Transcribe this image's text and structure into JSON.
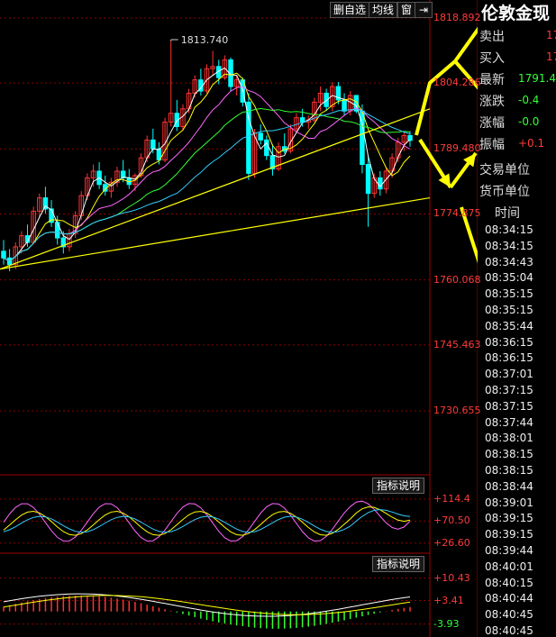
{
  "toolbar": {
    "delete_label": "删自选",
    "ma_label": "均线",
    "window_label": "窗"
  },
  "quote_panel": {
    "title": "伦敦金现",
    "rows": [
      {
        "label": "卖出",
        "value": "17",
        "color": "#ff3b3b"
      },
      {
        "label": "买入",
        "value": "17",
        "color": "#ff3b3b"
      },
      {
        "label": "最新",
        "value": "1791.4",
        "color": "#33ff33"
      },
      {
        "label": "涨跌",
        "value": "-0.4",
        "color": "#33ff33"
      },
      {
        "label": "涨幅",
        "value": "-0.0",
        "color": "#33ff33"
      },
      {
        "label": "振幅",
        "value": "+0.1",
        "color": "#ff3b3b"
      }
    ],
    "trade_unit_label": "交易单位",
    "currency_unit_label": "货币单位",
    "time_header": "时间",
    "times": [
      "08:34:15",
      "08:34:15",
      "08:34:43",
      "08:35:04",
      "08:35:15",
      "08:35:15",
      "08:35:44",
      "08:36:15",
      "08:36:15",
      "08:37:01",
      "08:37:15",
      "08:37:15",
      "08:37:44",
      "08:38:01",
      "08:38:15",
      "08:38:15",
      "08:38:44",
      "08:39:01",
      "08:39:15",
      "08:39:15",
      "08:39:44",
      "08:40:01",
      "08:40:15",
      "08:40:44",
      "08:40:45",
      "08:40:45"
    ]
  },
  "indicator_button_label": "指标说明",
  "colors": {
    "up": "#ff3333",
    "down": "#00ffff",
    "ma_white": "#ffffff",
    "ma_yellow": "#ffff00",
    "ma_magenta": "#ff66ff",
    "ma_green": "#33ff33",
    "ma_blue": "#33ccff",
    "grid": "#8b0000",
    "arrow": "#ffff00"
  },
  "chart_data": [
    {
      "type": "candlestick",
      "price_axis_labels": [
        "1818.892",
        "1804.286",
        "1789.480",
        "1774.875",
        "1760.068",
        "1745.463",
        "1730.655"
      ],
      "ylim": [
        1730.655,
        1818.892
      ],
      "high_annotation": "1813.740",
      "ohlc": [
        [
          1766.5,
          1769.0,
          1763.5,
          1765.0
        ],
        [
          1765.0,
          1767.0,
          1762.0,
          1763.5
        ],
        [
          1763.5,
          1768.5,
          1762.5,
          1767.5
        ],
        [
          1767.5,
          1771.0,
          1766.0,
          1770.0
        ],
        [
          1770.0,
          1772.5,
          1767.5,
          1768.5
        ],
        [
          1768.5,
          1776.5,
          1768.0,
          1775.5
        ],
        [
          1775.5,
          1779.5,
          1774.0,
          1778.5
        ],
        [
          1778.5,
          1781.0,
          1775.0,
          1776.0
        ],
        [
          1776.0,
          1778.0,
          1772.0,
          1773.0
        ],
        [
          1773.0,
          1774.5,
          1768.0,
          1769.5
        ],
        [
          1769.5,
          1771.0,
          1766.0,
          1767.5
        ],
        [
          1767.5,
          1771.5,
          1766.5,
          1770.5
        ],
        [
          1770.5,
          1775.5,
          1769.5,
          1774.5
        ],
        [
          1774.5,
          1780.0,
          1773.5,
          1779.0
        ],
        [
          1779.0,
          1784.0,
          1778.0,
          1783.0
        ],
        [
          1783.0,
          1786.0,
          1781.0,
          1784.5
        ],
        [
          1784.5,
          1786.5,
          1780.5,
          1781.5
        ],
        [
          1781.5,
          1783.5,
          1779.0,
          1780.0
        ],
        [
          1780.0,
          1783.0,
          1778.5,
          1782.0
        ],
        [
          1782.0,
          1785.5,
          1781.0,
          1784.5
        ],
        [
          1784.5,
          1787.0,
          1782.0,
          1783.0
        ],
        [
          1783.0,
          1785.0,
          1780.5,
          1781.5
        ],
        [
          1781.5,
          1784.0,
          1780.0,
          1783.5
        ],
        [
          1783.5,
          1788.5,
          1783.0,
          1787.5
        ],
        [
          1787.5,
          1792.5,
          1786.5,
          1791.5
        ],
        [
          1791.5,
          1794.0,
          1788.5,
          1789.5
        ],
        [
          1789.5,
          1791.0,
          1786.0,
          1787.0
        ],
        [
          1787.0,
          1796.5,
          1786.5,
          1795.5
        ],
        [
          1795.5,
          1813.7,
          1794.5,
          1797.5
        ],
        [
          1797.5,
          1800.5,
          1793.5,
          1794.5
        ],
        [
          1794.5,
          1799.5,
          1793.5,
          1798.5
        ],
        [
          1798.5,
          1803.0,
          1797.5,
          1802.0
        ],
        [
          1802.0,
          1806.0,
          1801.0,
          1805.0
        ],
        [
          1805.0,
          1807.5,
          1801.5,
          1802.5
        ],
        [
          1802.5,
          1808.5,
          1802.0,
          1807.5
        ],
        [
          1807.5,
          1811.5,
          1806.0,
          1808.0
        ],
        [
          1808.0,
          1809.5,
          1804.0,
          1805.5
        ],
        [
          1805.5,
          1810.5,
          1805.0,
          1809.5
        ],
        [
          1809.5,
          1810.0,
          1802.5,
          1803.5
        ],
        [
          1803.5,
          1806.0,
          1801.5,
          1805.0
        ],
        [
          1805.0,
          1805.5,
          1799.0,
          1800.0
        ],
        [
          1800.0,
          1802.0,
          1782.5,
          1784.0
        ],
        [
          1784.0,
          1794.0,
          1783.0,
          1793.0
        ],
        [
          1793.0,
          1795.0,
          1790.5,
          1791.5
        ],
        [
          1791.5,
          1792.5,
          1787.0,
          1788.0
        ],
        [
          1788.0,
          1790.5,
          1783.5,
          1785.0
        ],
        [
          1785.0,
          1791.0,
          1784.5,
          1790.0
        ],
        [
          1790.0,
          1793.0,
          1788.5,
          1789.0
        ],
        [
          1789.0,
          1795.0,
          1788.5,
          1794.0
        ],
        [
          1794.0,
          1797.5,
          1793.0,
          1796.5
        ],
        [
          1796.5,
          1798.5,
          1794.5,
          1795.5
        ],
        [
          1795.5,
          1797.0,
          1794.0,
          1796.0
        ],
        [
          1796.0,
          1801.0,
          1795.5,
          1800.0
        ],
        [
          1800.0,
          1803.5,
          1798.0,
          1802.0
        ],
        [
          1802.0,
          1803.0,
          1798.0,
          1799.0
        ],
        [
          1799.0,
          1804.5,
          1798.0,
          1803.5
        ],
        [
          1803.5,
          1804.5,
          1799.5,
          1800.5
        ],
        [
          1800.5,
          1802.0,
          1797.0,
          1798.0
        ],
        [
          1798.0,
          1802.5,
          1797.0,
          1801.5
        ],
        [
          1801.5,
          1801.5,
          1797.5,
          1798.0
        ],
        [
          1798.0,
          1799.5,
          1784.0,
          1786.0
        ],
        [
          1786.0,
          1788.0,
          1772.0,
          1779.5
        ],
        [
          1779.5,
          1784.0,
          1778.5,
          1783.0
        ],
        [
          1783.0,
          1784.5,
          1779.0,
          1780.5
        ],
        [
          1780.5,
          1785.5,
          1779.5,
          1784.5
        ],
        [
          1784.5,
          1788.5,
          1783.0,
          1787.5
        ],
        [
          1787.5,
          1792.0,
          1786.5,
          1791.0
        ],
        [
          1791.0,
          1793.5,
          1789.0,
          1792.5
        ],
        [
          1792.5,
          1793.5,
          1790.0,
          1791.4
        ]
      ]
    },
    {
      "type": "line",
      "indicator": "oscillator",
      "axis_labels": [
        "+114.4",
        "+70.50",
        "+26.60"
      ],
      "ylim": [
        10,
        125
      ]
    },
    {
      "type": "bar",
      "indicator": "macd",
      "axis_labels": [
        "+10.43",
        "+3.41",
        "-3.93"
      ],
      "ylim": [
        -6,
        12
      ]
    }
  ]
}
